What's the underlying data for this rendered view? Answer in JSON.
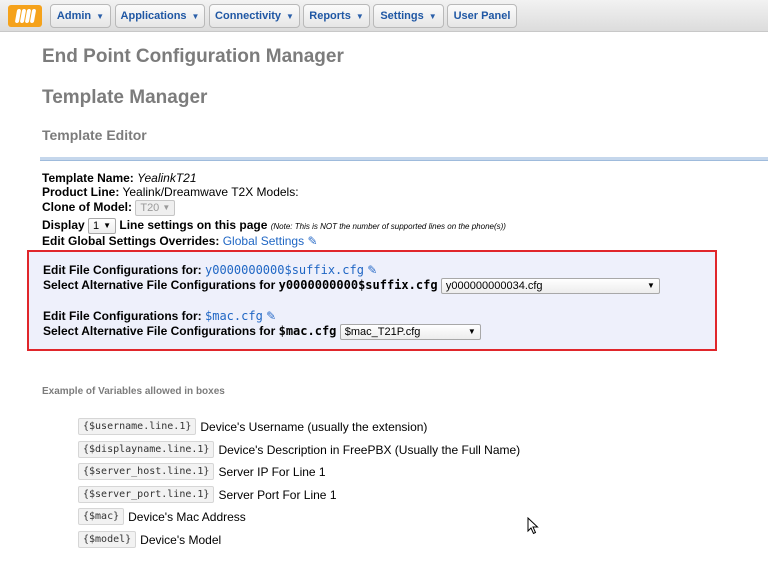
{
  "nav": {
    "items": [
      {
        "label": "Admin"
      },
      {
        "label": "Applications"
      },
      {
        "label": "Connectivity"
      },
      {
        "label": "Reports"
      },
      {
        "label": "Settings"
      },
      {
        "label": "User Panel"
      }
    ]
  },
  "page": {
    "title": "End Point Configuration Manager",
    "subtitle": "Template Manager",
    "section": "Template Editor"
  },
  "template": {
    "name_label": "Template Name:",
    "name_value": "YealinkT21",
    "product_label": "Product Line:",
    "product_value": "Yealink/Dreamwave T2X Models:",
    "clone_label": "Clone of Model:",
    "clone_value": "T20",
    "display_label": "Display",
    "display_value": "1",
    "display_suffix": "Line settings on this page",
    "display_note": "(Note: This is NOT the number of supported lines on the phone(s))",
    "global_label": "Edit Global Settings Overrides:",
    "global_link": "Global Settings"
  },
  "file_configs": [
    {
      "edit_label": "Edit File Configurations for:",
      "file": "y0000000000$suffix.cfg",
      "alt_label": "Select Alternative File Configurations for",
      "alt_file": "y0000000000$suffix.cfg",
      "alt_selected": "y000000000034.cfg"
    },
    {
      "edit_label": "Edit File Configurations for:",
      "file": "$mac.cfg",
      "alt_label": "Select Alternative File Configurations for",
      "alt_file": "$mac.cfg",
      "alt_selected": "$mac_T21P.cfg"
    }
  ],
  "variables": {
    "title": "Example of Variables allowed in boxes",
    "items": [
      {
        "code": "{$username.line.1}",
        "desc": "Device's Username (usually the extension)"
      },
      {
        "code": "{$displayname.line.1}",
        "desc": "Device's Description in FreePBX (Usually the Full Name)"
      },
      {
        "code": "{$server_host.line.1}",
        "desc": "Server IP For Line 1"
      },
      {
        "code": "{$server_port.line.1}",
        "desc": "Server Port For Line 1"
      },
      {
        "code": "{$mac}",
        "desc": "Device's Mac Address"
      },
      {
        "code": "{$model}",
        "desc": "Device's Model"
      }
    ]
  },
  "colors": {
    "accent": "#1f66c4",
    "highlight_border": "#e0262b",
    "logo": "#f5a21b"
  }
}
